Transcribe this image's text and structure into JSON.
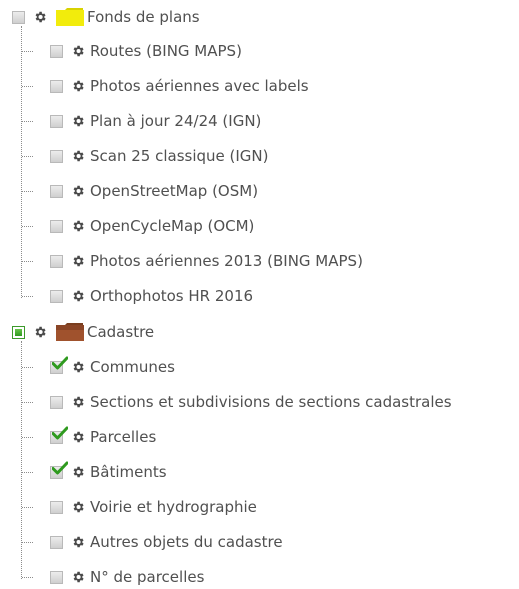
{
  "groups": [
    {
      "label": "Fonds de plans",
      "folder_color": "#f2ec0c",
      "checkbox_state": "unchecked",
      "layers": [
        {
          "label": "Routes (BING MAPS)",
          "checked": false
        },
        {
          "label": "Photos aériennes avec labels",
          "checked": false
        },
        {
          "label": "Plan à jour 24/24 (IGN)",
          "checked": false
        },
        {
          "label": "Scan 25 classique (IGN)",
          "checked": false
        },
        {
          "label": "OpenStreetMap (OSM)",
          "checked": false
        },
        {
          "label": "OpenCycleMap (OCM)",
          "checked": false
        },
        {
          "label": "Photos aériennes 2013 (BING MAPS)",
          "checked": false
        },
        {
          "label": "Orthophotos HR 2016",
          "checked": false
        }
      ]
    },
    {
      "label": "Cadastre",
      "folder_color": "#a0522d",
      "checkbox_state": "partial",
      "layers": [
        {
          "label": "Communes",
          "checked": true
        },
        {
          "label": "Sections et subdivisions de sections cadastrales",
          "checked": false
        },
        {
          "label": "Parcelles",
          "checked": true
        },
        {
          "label": "Bâtiments",
          "checked": true
        },
        {
          "label": "Voirie et hydrographie",
          "checked": false
        },
        {
          "label": "Autres objets du cadastre",
          "checked": false
        },
        {
          "label": "N° de parcelles",
          "checked": false
        }
      ]
    }
  ],
  "icons": {
    "settings": "gear-icon",
    "group": "folder-icon",
    "checked_mark": "checkmark-icon"
  },
  "colors": {
    "text": "#505050",
    "check_green": "#2f9a1f",
    "tree_line": "#8c8c8c"
  }
}
